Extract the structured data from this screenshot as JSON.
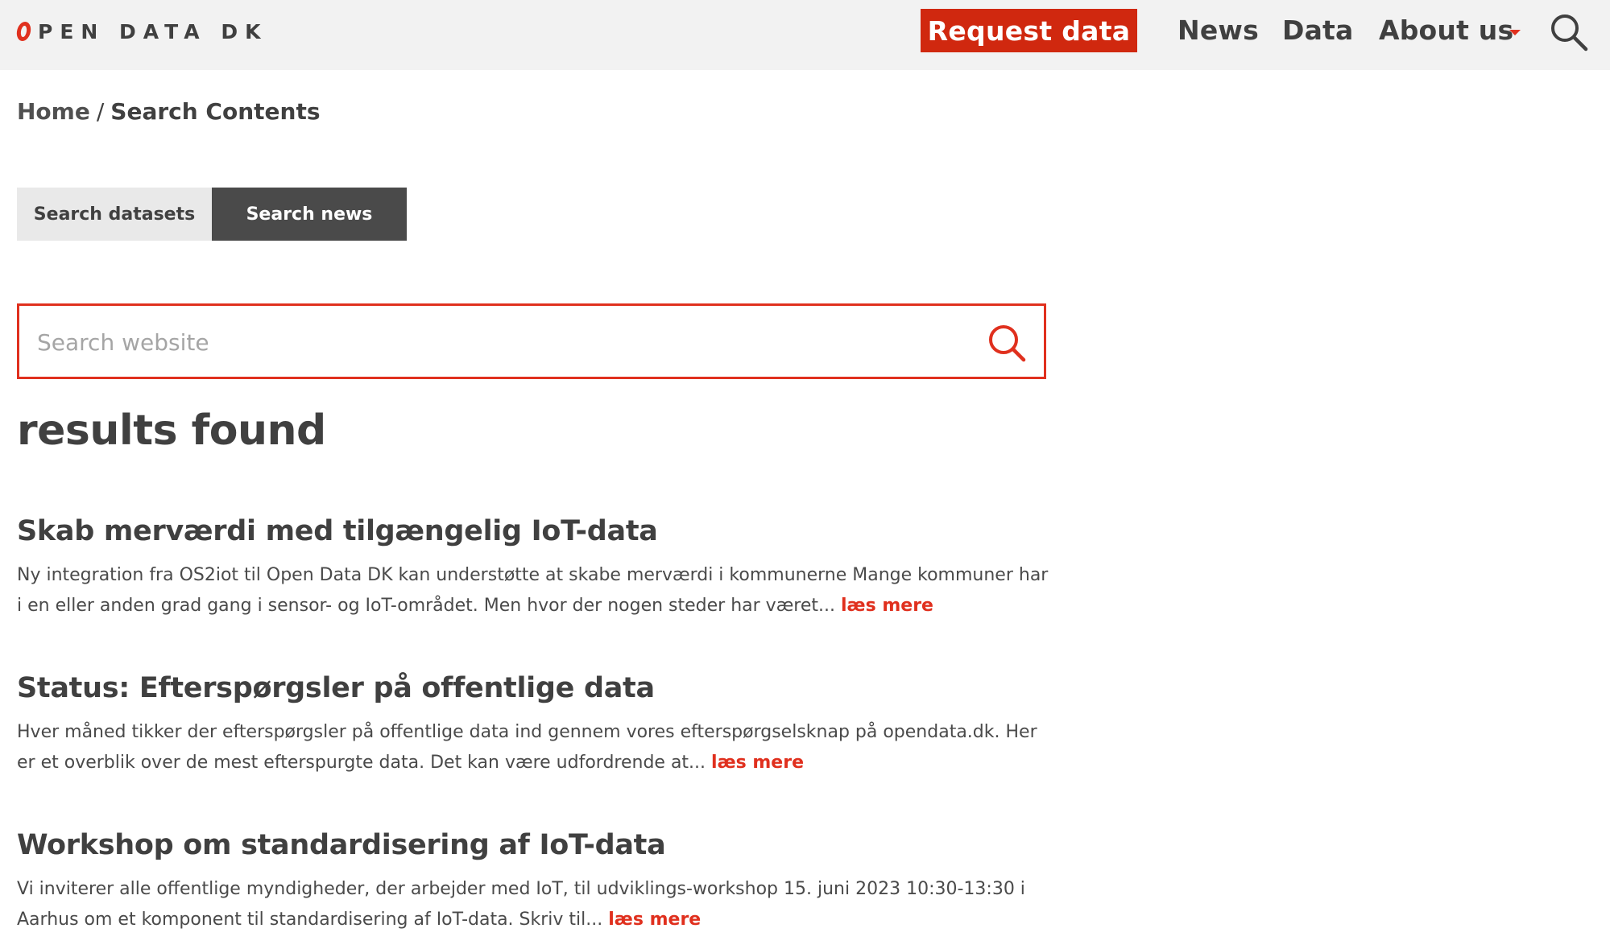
{
  "header": {
    "logo_text": "PEN DATA DK",
    "request_label": "Request data",
    "nav": {
      "news": "News",
      "data": "Data",
      "about": "About us"
    }
  },
  "breadcrumb": {
    "home": "Home",
    "separator": "/",
    "current": "Search Contents"
  },
  "tabs": {
    "datasets": "Search datasets",
    "news": "Search news"
  },
  "search": {
    "placeholder": "Search website",
    "value": ""
  },
  "results_heading": "results found",
  "articles": [
    {
      "title": "Skab merværdi med tilgængelig IoT-data",
      "excerpt": "Ny integration fra OS2iot til Open Data DK kan understøtte at skabe merværdi i kommunerne Mange kommuner har i en eller anden grad gang i sensor- og IoT-området. Men hvor der nogen steder har været...",
      "read_more": "læs mere"
    },
    {
      "title": "Status: Efterspørgsler på offentlige data",
      "excerpt": "Hver måned tikker der efterspørgsler på offentlige data ind gennem vores efterspørgselsknap på opendata.dk. Her er et overblik over de mest efterspurgte data. Det kan være udfordrende at...",
      "read_more": "læs mere"
    },
    {
      "title": "Workshop om standardisering af IoT-data",
      "excerpt": "Vi inviterer alle offentlige myndigheder, der arbejder med IoT, til udviklings-workshop 15. juni 2023 10:30-13:30 i Aarhus om et komponent til standardisering af IoT-data. Skriv til...",
      "read_more": "læs mere"
    }
  ],
  "colors": {
    "accent": "#e0301e",
    "button_red": "#d0280f",
    "header_bg": "#f2f2f2",
    "text_dark": "#404040",
    "tab_active_bg": "#4a4a4a",
    "tab_inactive_bg": "#e9e9e9"
  },
  "icons": {
    "logo": "open-data-o-icon",
    "header_search": "search-icon",
    "caret": "caret-down-icon",
    "search_submit": "search-icon"
  }
}
